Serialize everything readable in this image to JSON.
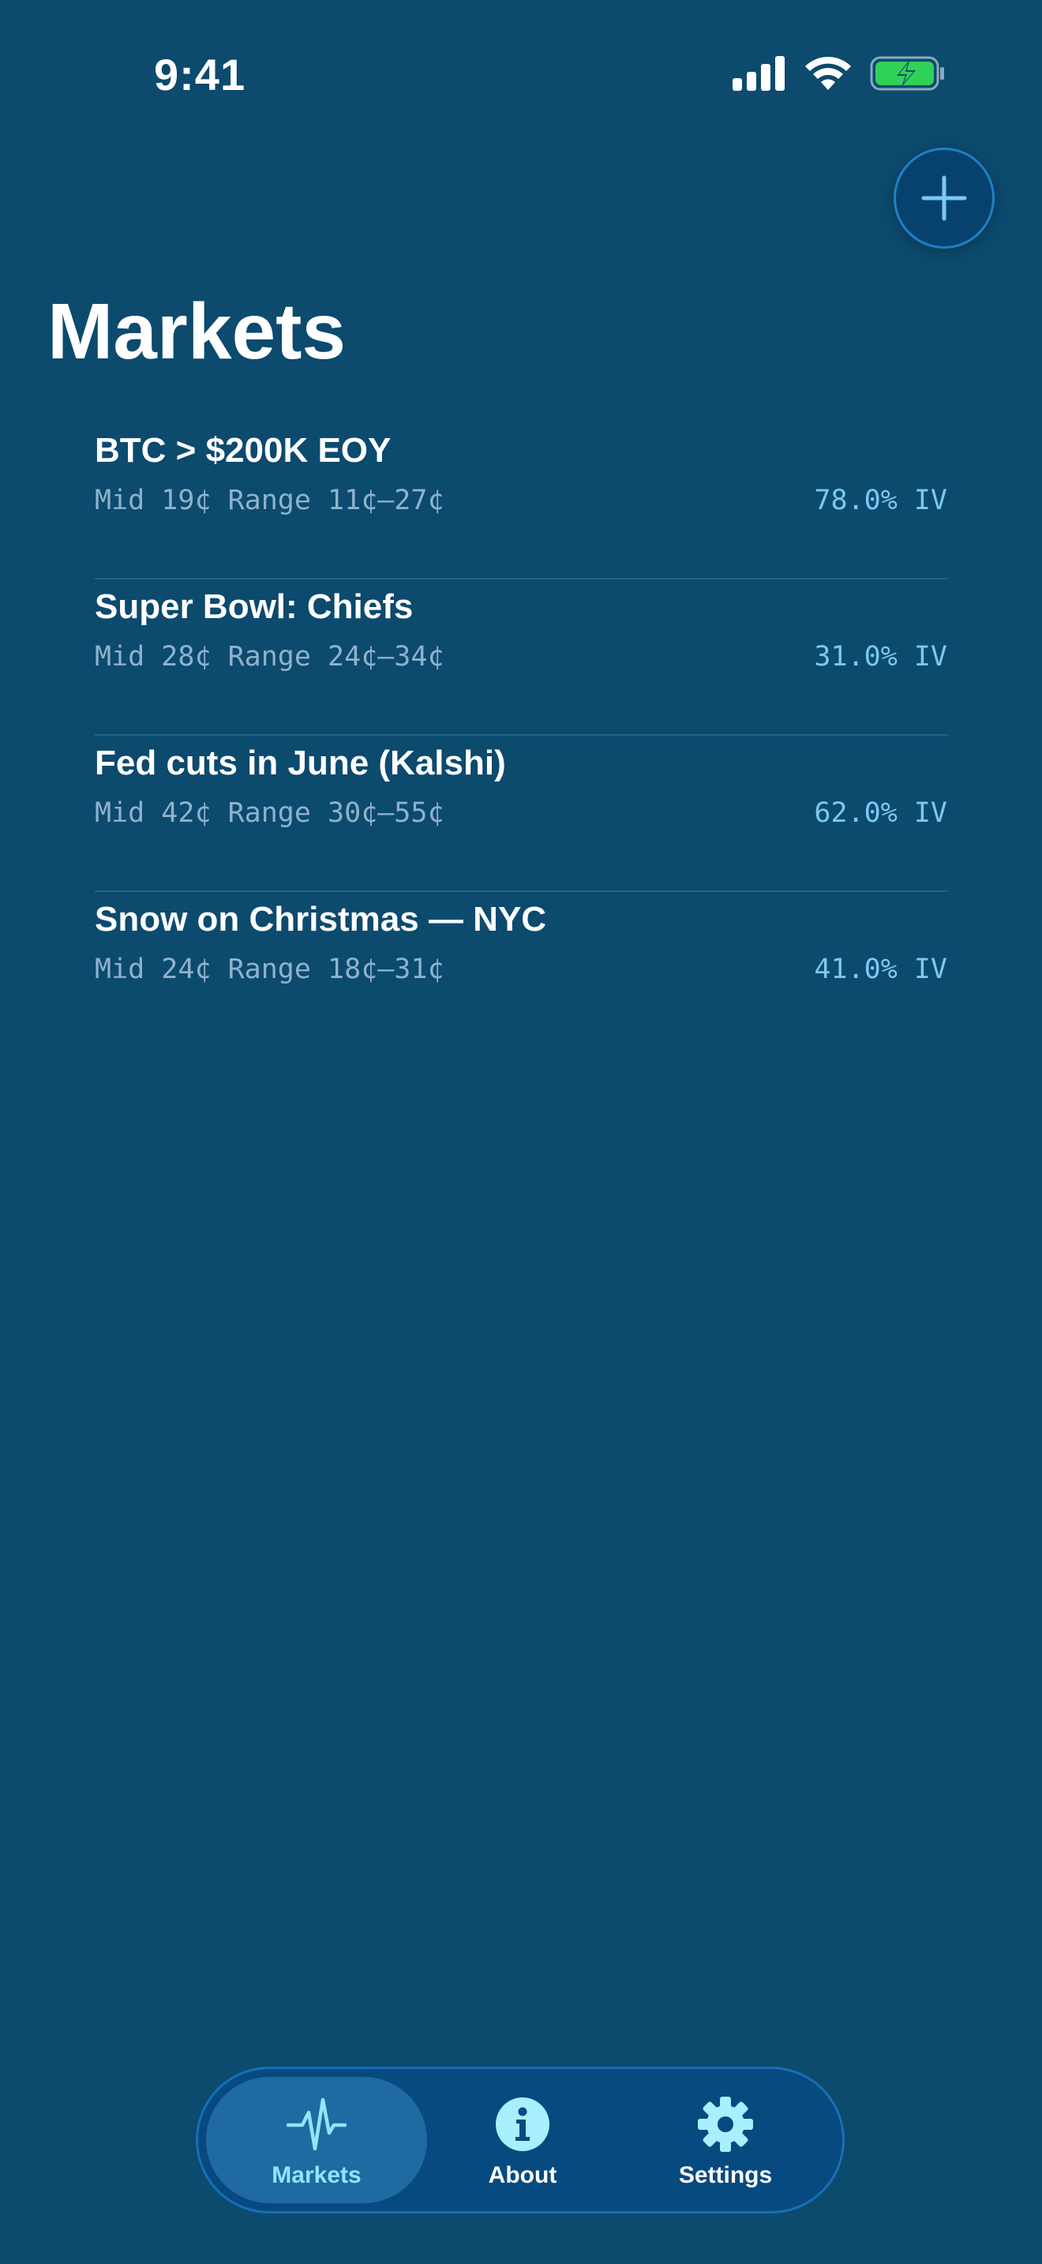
{
  "status_bar": {
    "time": "9:41"
  },
  "page": {
    "title": "Markets"
  },
  "markets": [
    {
      "name": "BTC > $200K EOY",
      "meta": "Mid 19¢ Range 11¢–27¢",
      "iv": "78.0% IV"
    },
    {
      "name": "Super Bowl: Chiefs",
      "meta": "Mid 28¢ Range 24¢–34¢",
      "iv": "31.0% IV"
    },
    {
      "name": "Fed cuts in June (Kalshi)",
      "meta": "Mid 42¢ Range 30¢–55¢",
      "iv": "62.0% IV"
    },
    {
      "name": "Snow on Christmas — NYC",
      "meta": "Mid 24¢ Range 18¢–31¢",
      "iv": "41.0% IV"
    }
  ],
  "tab_bar": {
    "tabs": [
      {
        "label": "Markets",
        "icon": "waveform-icon",
        "active": true
      },
      {
        "label": "About",
        "icon": "info-icon",
        "active": false
      },
      {
        "label": "Settings",
        "icon": "gear-icon",
        "active": false
      }
    ]
  },
  "colors": {
    "background": "#0c4a6e",
    "accent": "#7cc8f2",
    "active_tab_label": "#8fe6ff",
    "battery_fill": "#30d158"
  }
}
